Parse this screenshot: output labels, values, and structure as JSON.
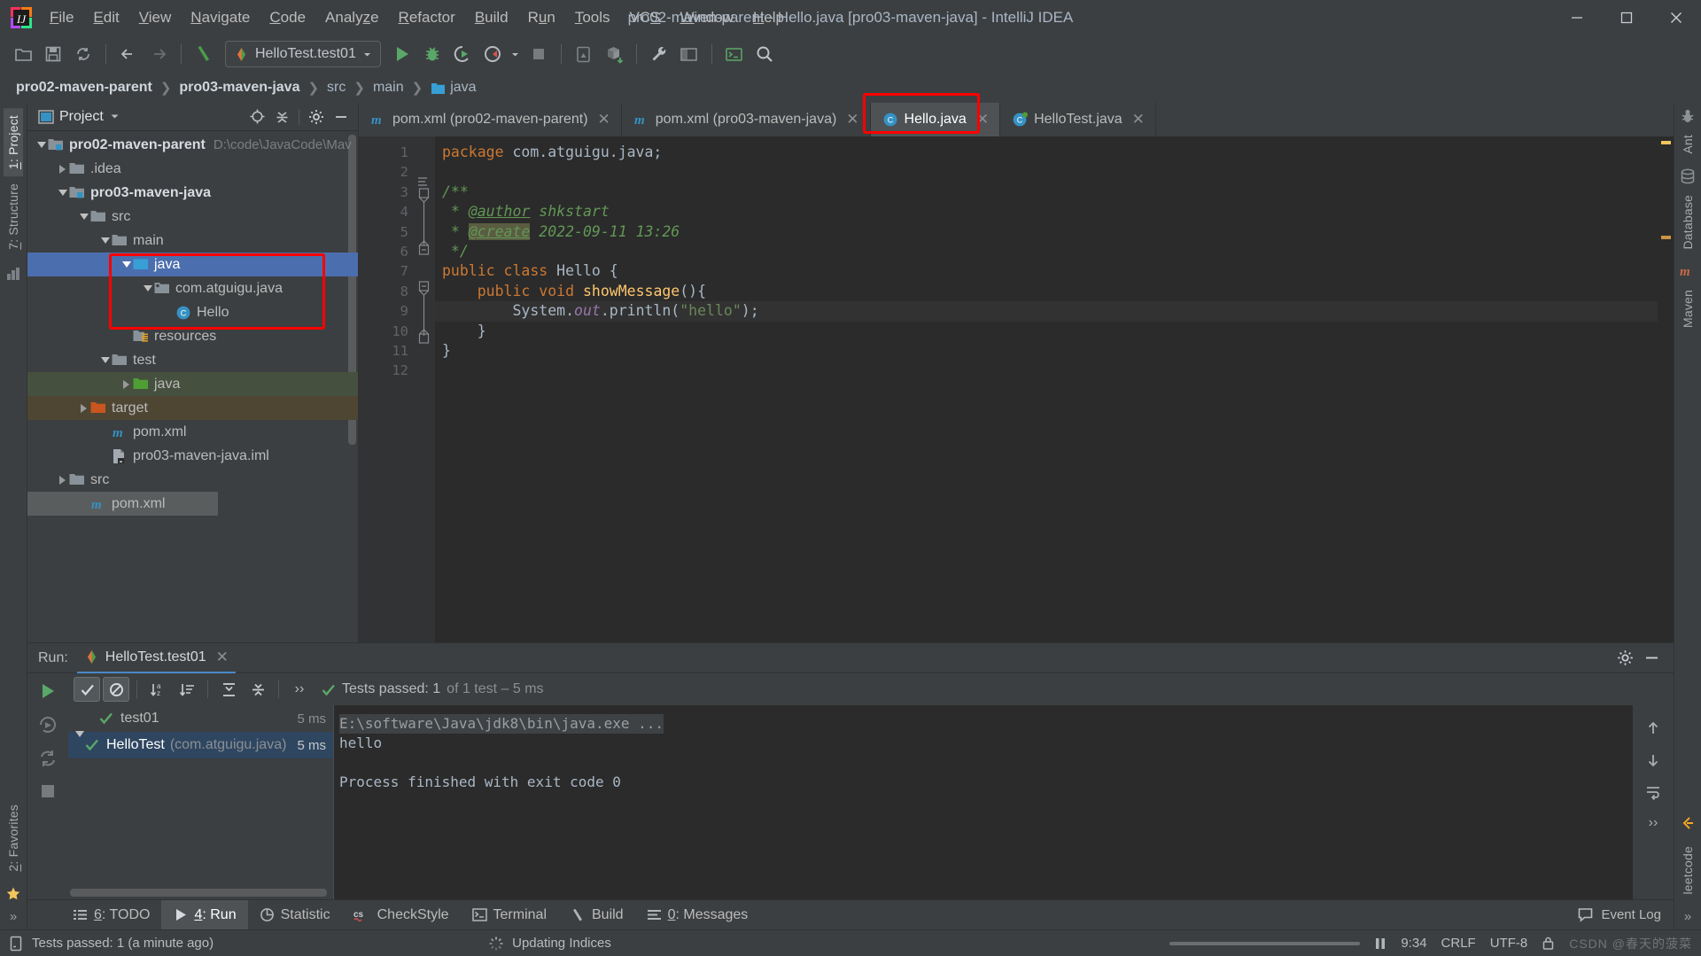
{
  "window": {
    "title": "pro02-maven-parent - Hello.java [pro03-maven-java] - IntelliJ IDEA",
    "minimize": "–",
    "maximize": "❐",
    "close": "✕"
  },
  "menubar": [
    {
      "label": "File",
      "mnemonic": "F"
    },
    {
      "label": "Edit",
      "mnemonic": "E"
    },
    {
      "label": "View",
      "mnemonic": "V"
    },
    {
      "label": "Navigate",
      "mnemonic": "N"
    },
    {
      "label": "Code",
      "mnemonic": "C"
    },
    {
      "label": "Analyze",
      "mnemonic": "z"
    },
    {
      "label": "Refactor",
      "mnemonic": "R"
    },
    {
      "label": "Build",
      "mnemonic": "B"
    },
    {
      "label": "Run",
      "mnemonic": "u"
    },
    {
      "label": "Tools",
      "mnemonic": "T"
    },
    {
      "label": "VCS",
      "mnemonic": "S"
    },
    {
      "label": "Window",
      "mnemonic": "W"
    },
    {
      "label": "Help",
      "mnemonic": "H"
    }
  ],
  "toolbar": {
    "open_icon": "open-folder-icon",
    "save_icon": "save-icon",
    "sync_icon": "sync-icon",
    "back_icon": "back-arrow-icon",
    "forward_icon": "forward-arrow-icon",
    "build_icon": "build-hammer-icon",
    "run_config": "HelloTest.test01",
    "run_icon": "run-icon",
    "debug_icon": "debug-icon",
    "run_coverage_icon": "run-with-coverage-icon",
    "profile_icon": "profiler-icon",
    "stop_icon": "stop-icon",
    "avd_icon": "avd-manager-icon",
    "sdk_icon": "sdk-manager-icon",
    "settings_icon": "settings-wrench-icon",
    "project-structure_icon": "project-structure-icon",
    "terminal_icon": "terminal-icon",
    "search_icon": "search-everywhere-icon"
  },
  "breadcrumb": [
    {
      "label": "pro02-maven-parent",
      "bold": true,
      "icon": ""
    },
    {
      "label": "pro03-maven-java",
      "bold": true,
      "icon": ""
    },
    {
      "label": "src",
      "bold": false,
      "icon": ""
    },
    {
      "label": "main",
      "bold": false,
      "icon": ""
    },
    {
      "label": "java",
      "bold": false,
      "icon": "source-folder-icon"
    }
  ],
  "left_strip": {
    "tabs": [
      {
        "label": "1: Project",
        "mnemonic": "1",
        "active": true
      },
      {
        "label": "7: Structure",
        "mnemonic": "7",
        "active": false
      }
    ],
    "bottom_tabs": [
      {
        "label": "2: Favorites",
        "mnemonic": "2"
      }
    ],
    "bottom_icon": "more-chevrons-icon"
  },
  "right_strip": {
    "tabs": [
      {
        "label": "Ant",
        "icon": "ant-icon"
      },
      {
        "label": "Database",
        "icon": "database-icon"
      },
      {
        "label": "Maven",
        "icon": "maven-icon"
      },
      {
        "label": "leetcode",
        "icon": "leetcode-icon"
      }
    ]
  },
  "project_panel": {
    "title": "Project",
    "dropdown_icon": "chevron-down-icon",
    "actions": [
      "locate-icon",
      "collapse-all-icon",
      "gear-icon",
      "hide-icon"
    ],
    "tree": [
      {
        "indent": 0,
        "arrow": "down",
        "icon": "module-root-icon",
        "label": "pro02-maven-parent",
        "bold": true,
        "path": "D:\\code\\JavaCode\\Mav",
        "state": "none"
      },
      {
        "indent": 1,
        "arrow": "right",
        "icon": "folder-icon",
        "label": ".idea",
        "bold": false,
        "path": "",
        "state": "none"
      },
      {
        "indent": 1,
        "arrow": "down",
        "icon": "module-root-icon",
        "label": "pro03-maven-java",
        "bold": true,
        "path": "",
        "state": "none"
      },
      {
        "indent": 2,
        "arrow": "down",
        "icon": "folder-icon",
        "label": "src",
        "bold": false,
        "path": "",
        "state": "none"
      },
      {
        "indent": 3,
        "arrow": "down",
        "icon": "folder-icon",
        "label": "main",
        "bold": false,
        "path": "",
        "state": "none"
      },
      {
        "indent": 4,
        "arrow": "down",
        "icon": "source-folder-icon",
        "label": "java",
        "bold": false,
        "path": "",
        "state": "selected"
      },
      {
        "indent": 5,
        "arrow": "down",
        "icon": "package-icon",
        "label": "com.atguigu.java",
        "bold": false,
        "path": "",
        "state": "none"
      },
      {
        "indent": 6,
        "arrow": "none",
        "icon": "class-icon",
        "label": "Hello",
        "bold": false,
        "path": "",
        "state": "none"
      },
      {
        "indent": 4,
        "arrow": "none",
        "icon": "resources-folder-icon",
        "label": "resources",
        "bold": false,
        "path": "",
        "state": "none"
      },
      {
        "indent": 3,
        "arrow": "down",
        "icon": "folder-icon",
        "label": "test",
        "bold": false,
        "path": "",
        "state": "none"
      },
      {
        "indent": 4,
        "arrow": "right",
        "icon": "test-folder-icon",
        "label": "java",
        "bold": false,
        "path": "",
        "state": "green"
      },
      {
        "indent": 2,
        "arrow": "right",
        "icon": "target-folder-icon",
        "label": "target",
        "bold": false,
        "path": "",
        "state": "brown"
      },
      {
        "indent": 3,
        "arrow": "none",
        "icon": "maven-file-icon",
        "label": "pom.xml",
        "bold": false,
        "path": "",
        "state": "none"
      },
      {
        "indent": 3,
        "arrow": "none",
        "icon": "iml-file-icon",
        "label": "pro03-maven-java.iml",
        "bold": false,
        "path": "",
        "state": "none"
      },
      {
        "indent": 1,
        "arrow": "right",
        "icon": "folder-icon",
        "label": "src",
        "bold": false,
        "path": "",
        "state": "none"
      },
      {
        "indent": 2,
        "arrow": "none",
        "icon": "maven-file-icon",
        "label": "pom.xml",
        "bold": false,
        "path": "",
        "state": "grey"
      }
    ]
  },
  "editor": {
    "tabs": [
      {
        "label": "pom.xml (pro02-maven-parent)",
        "icon": "maven-file-icon",
        "active": false,
        "highlight": false,
        "close": "✕"
      },
      {
        "label": "pom.xml (pro03-maven-java)",
        "icon": "maven-file-icon",
        "active": false,
        "highlight": false,
        "close": "✕"
      },
      {
        "label": "Hello.java",
        "icon": "class-icon",
        "active": true,
        "highlight": true,
        "close": "✕"
      },
      {
        "label": "HelloTest.java",
        "icon": "test-class-icon",
        "active": false,
        "highlight": false,
        "close": "✕"
      }
    ],
    "line_numbers": [
      1,
      2,
      3,
      4,
      5,
      6,
      7,
      8,
      9,
      10,
      11,
      12
    ],
    "code_lines": [
      {
        "n": 1,
        "tokens": [
          {
            "t": "package ",
            "c": "kw"
          },
          {
            "t": "com.atguigu.java;",
            "c": "white"
          }
        ]
      },
      {
        "n": 2,
        "tokens": []
      },
      {
        "n": 3,
        "tokens": [
          {
            "t": "/**",
            "c": "cmt"
          }
        ]
      },
      {
        "n": 4,
        "tokens": [
          {
            "t": " * ",
            "c": "cmt"
          },
          {
            "t": "@author",
            "c": "tag"
          },
          {
            "t": " shkstart",
            "c": "cmt"
          }
        ]
      },
      {
        "n": 5,
        "tokens": [
          {
            "t": " * ",
            "c": "cmt"
          },
          {
            "t": "@create",
            "c": "tag-hl"
          },
          {
            "t": " 2022-09-11 13:26",
            "c": "cmt"
          }
        ]
      },
      {
        "n": 6,
        "tokens": [
          {
            "t": " */",
            "c": "cmt"
          }
        ]
      },
      {
        "n": 7,
        "tokens": [
          {
            "t": "public class ",
            "c": "kw"
          },
          {
            "t": "Hello ",
            "c": "cls"
          },
          {
            "t": "{",
            "c": "white"
          }
        ]
      },
      {
        "n": 8,
        "tokens": [
          {
            "t": "    ",
            "c": "white"
          },
          {
            "t": "public void ",
            "c": "kw"
          },
          {
            "t": "showMessage",
            "c": "mth"
          },
          {
            "t": "(){",
            "c": "white"
          }
        ]
      },
      {
        "n": 9,
        "tokens": [
          {
            "t": "        System.",
            "c": "white"
          },
          {
            "t": "out",
            "c": "fld"
          },
          {
            "t": ".println(",
            "c": "white"
          },
          {
            "t": "\"hello\"",
            "c": "str"
          },
          {
            "t": ");",
            "c": "white"
          }
        ]
      },
      {
        "n": 10,
        "tokens": [
          {
            "t": "    }",
            "c": "white"
          }
        ]
      },
      {
        "n": 11,
        "tokens": [
          {
            "t": "}",
            "c": "white"
          }
        ]
      },
      {
        "n": 12,
        "tokens": []
      }
    ],
    "caret_line": 9
  },
  "run_panel": {
    "label": "Run:",
    "tab": "HelloTest.test01",
    "tab_icon": "junit-icon",
    "close": "✕",
    "settings_icon": "gear-icon",
    "hide_icon": "hide-icon",
    "side_tools": [
      "rerun-icon",
      "rerun-failed-icon",
      "toggle-auto-test-icon",
      "stop-icon"
    ],
    "toolbar_buttons": [
      {
        "name": "show-passed-icon",
        "glyph": "✔",
        "on": true
      },
      {
        "name": "show-ignored-icon",
        "glyph": "⊘",
        "on": true
      },
      {
        "name": "sort-alphabetically-icon",
        "glyph": "↓a\nz",
        "on": false
      },
      {
        "name": "sort-by-duration-icon",
        "glyph": "↓≡",
        "on": false
      },
      {
        "name": "expand-all-icon",
        "glyph": "⤓",
        "on": false
      },
      {
        "name": "collapse-all-icon",
        "glyph": "⤒",
        "on": false
      },
      {
        "name": "more-icon",
        "glyph": "››",
        "on": false
      }
    ],
    "status_text": "Tests passed: 1",
    "status_suffix": "of 1 test – 5 ms",
    "test_tree": [
      {
        "indent": 0,
        "arrow": "down",
        "label": "HelloTest",
        "pkg": "(com.atguigu.java)",
        "time": "5 ms",
        "selected": true
      },
      {
        "indent": 1,
        "arrow": "none",
        "label": "test01",
        "pkg": "",
        "time": "5 ms",
        "selected": false
      }
    ],
    "console": [
      {
        "text": "E:\\software\\Java\\jdk8\\bin\\java.exe ...",
        "style": "cmd"
      },
      {
        "text": "hello",
        "style": "normal"
      },
      {
        "text": "",
        "style": "normal"
      },
      {
        "text": "Process finished with exit code 0",
        "style": "normal"
      }
    ],
    "console_side": [
      "scroll-up-icon",
      "scroll-down-icon",
      "soft-wrap-icon",
      "more-icon"
    ]
  },
  "bottom_tabs": [
    {
      "label": "6: TODO",
      "mnemonic": "6",
      "icon": "todo-icon",
      "active": false
    },
    {
      "label": "4: Run",
      "mnemonic": "4",
      "icon": "run-icon",
      "active": true
    },
    {
      "label": "Statistic",
      "mnemonic": "",
      "icon": "statistic-icon",
      "active": false
    },
    {
      "label": "CheckStyle",
      "mnemonic": "",
      "icon": "checkstyle-icon",
      "active": false
    },
    {
      "label": "Terminal",
      "mnemonic": "",
      "icon": "terminal-icon",
      "active": false
    },
    {
      "label": "Build",
      "mnemonic": "",
      "icon": "build-hammer-icon",
      "active": false
    },
    {
      "label": "0: Messages",
      "mnemonic": "0",
      "icon": "messages-icon",
      "active": false
    }
  ],
  "event_log": {
    "label": "Event Log",
    "icon": "event-log-icon"
  },
  "statusbar": {
    "message": "Tests passed: 1 (a minute ago)",
    "message_icon": "notification-icon",
    "background_task": "Updating Indices",
    "background_icon": "spinner-icon",
    "time": "9:34",
    "line_separator": "CRLF",
    "encoding": "UTF-8",
    "lock_icon": "read-only-lock-icon",
    "watermark": "CSDN @春天的菠菜"
  },
  "colors": {
    "accent_blue": "#4b6eaf",
    "highlight_red": "#ff0000",
    "editor_bg": "#2b2b2b",
    "panel_bg": "#3c3f41",
    "keyword_orange": "#cc7832",
    "string_green": "#6a8759",
    "comment_green": "#629755",
    "method_yellow": "#ffc66d",
    "field_purple": "#9876aa",
    "test_green": "#499c54"
  }
}
